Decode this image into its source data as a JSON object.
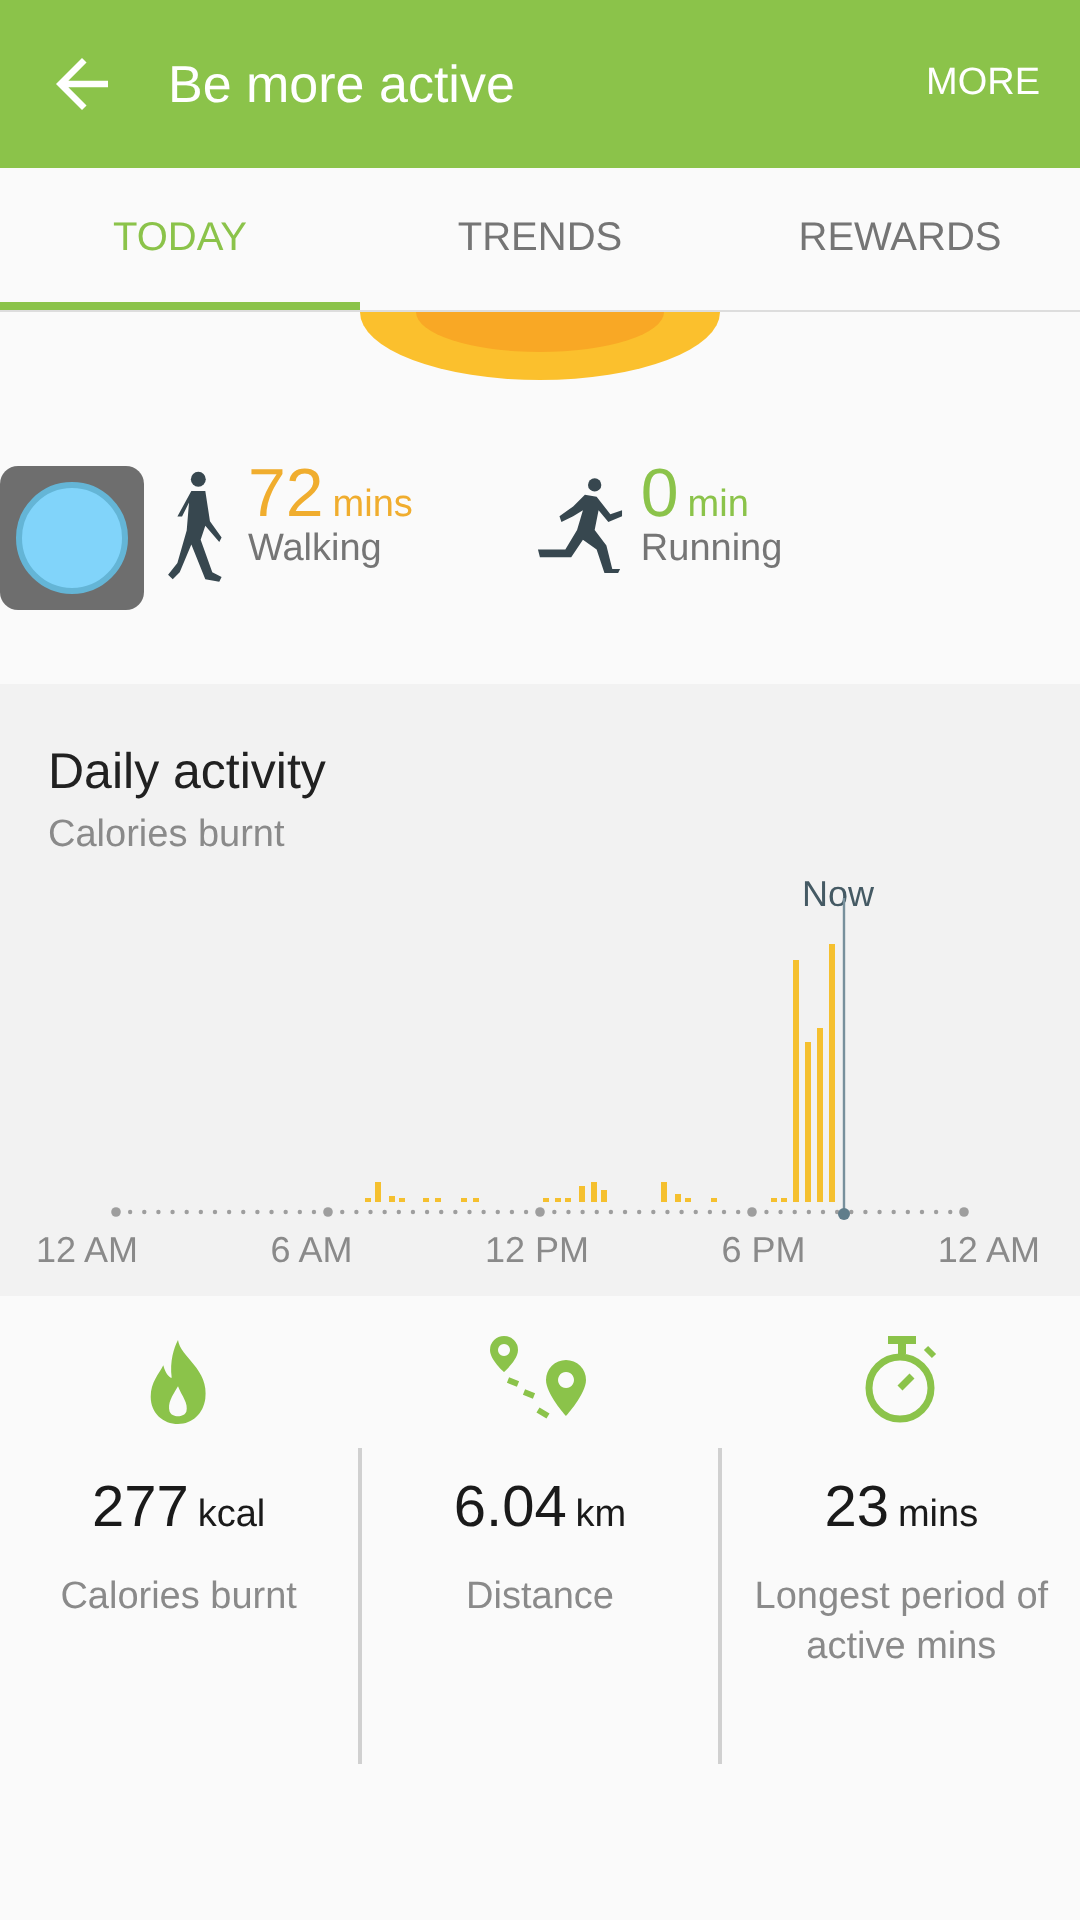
{
  "app_bar": {
    "title": "Be more active",
    "action": "MORE"
  },
  "tabs": [
    {
      "label": "TODAY",
      "selected": true
    },
    {
      "label": "TRENDS",
      "selected": false
    },
    {
      "label": "REWARDS",
      "selected": false
    }
  ],
  "activities": [
    {
      "kind": "walking",
      "value": "72",
      "unit": "mins",
      "label": "Walking"
    },
    {
      "kind": "running",
      "value": "0",
      "unit": "min",
      "label": "Running"
    }
  ],
  "daily_activity": {
    "title": "Daily activity",
    "subtitle": "Calories burnt",
    "now_label": "Now",
    "x_labels": [
      "12 AM",
      "6 AM",
      "12 PM",
      "6 PM",
      "12 AM"
    ]
  },
  "stats": [
    {
      "kind": "calories",
      "value": "277",
      "unit": "kcal",
      "label": "Calories burnt"
    },
    {
      "kind": "distance",
      "value": "6.04",
      "unit": "km",
      "label": "Distance"
    },
    {
      "kind": "duration",
      "value": "23",
      "unit": "mins",
      "label": "Longest period of active mins"
    }
  ]
}
